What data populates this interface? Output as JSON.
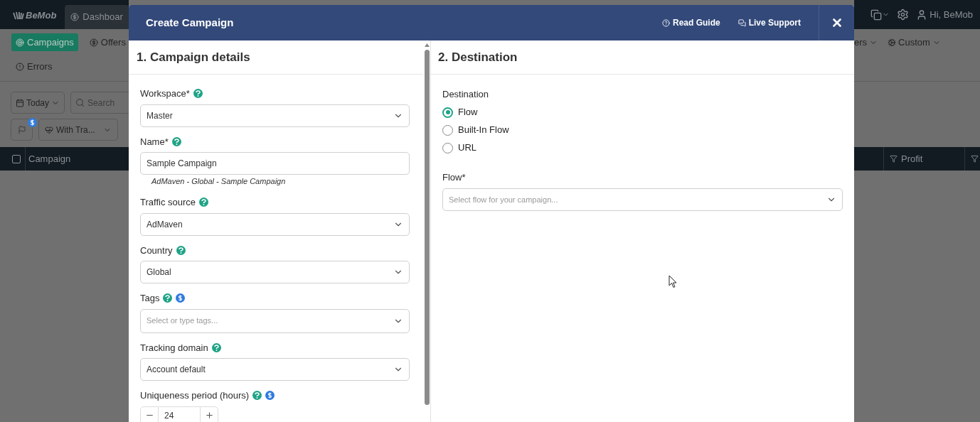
{
  "app": {
    "logo": "BeMob",
    "nav_tab": "Dashboar",
    "user": "Hi, BeMob",
    "menu": [
      {
        "label": "Campaigns",
        "selected": true
      },
      {
        "label": "Offers",
        "selected": false
      }
    ],
    "menu_row2": [
      {
        "label": "Errors",
        "selected": false
      }
    ],
    "menu_right": [
      {
        "label": "ers"
      },
      {
        "label": "Custom"
      }
    ],
    "date_button": "Today",
    "search_placeholder": "Search",
    "filter_dropdown": "With Tra...",
    "select_all_checked": false,
    "table_columns": [
      {
        "label": "Campaign"
      },
      {
        "label": "Profit"
      }
    ]
  },
  "modal": {
    "title": "Create Campaign",
    "actions": [
      "Read Guide",
      "Live Support"
    ],
    "left": {
      "title": "1. Campaign details",
      "fields": [
        {
          "kind": "select",
          "label": "Workspace*",
          "premium": false,
          "value": "Master"
        },
        {
          "kind": "text",
          "label": "Name*",
          "premium": false,
          "value": "Sample Campaign",
          "hint": "AdMaven - Global - Sample Campaign"
        },
        {
          "kind": "select",
          "label": "Traffic source",
          "premium": false,
          "value": "AdMaven"
        },
        {
          "kind": "select",
          "label": "Country",
          "premium": false,
          "value": "Global"
        },
        {
          "kind": "select",
          "label": "Tags",
          "premium": true,
          "placeholder": "Select or type tags..."
        },
        {
          "kind": "select",
          "label": "Tracking domain",
          "premium": false,
          "value": "Account default"
        },
        {
          "kind": "number",
          "label": "Uniqueness period (hours)",
          "premium": true,
          "value": "24"
        }
      ]
    },
    "right": {
      "title": "2. Destination",
      "radio_label": "Destination",
      "options": [
        {
          "label": "Flow",
          "selected": true
        },
        {
          "label": "Built-In Flow",
          "selected": false
        },
        {
          "label": "URL",
          "selected": false
        }
      ],
      "flow_label": "Flow*",
      "flow_placeholder": "Select flow for your campaign..."
    }
  }
}
